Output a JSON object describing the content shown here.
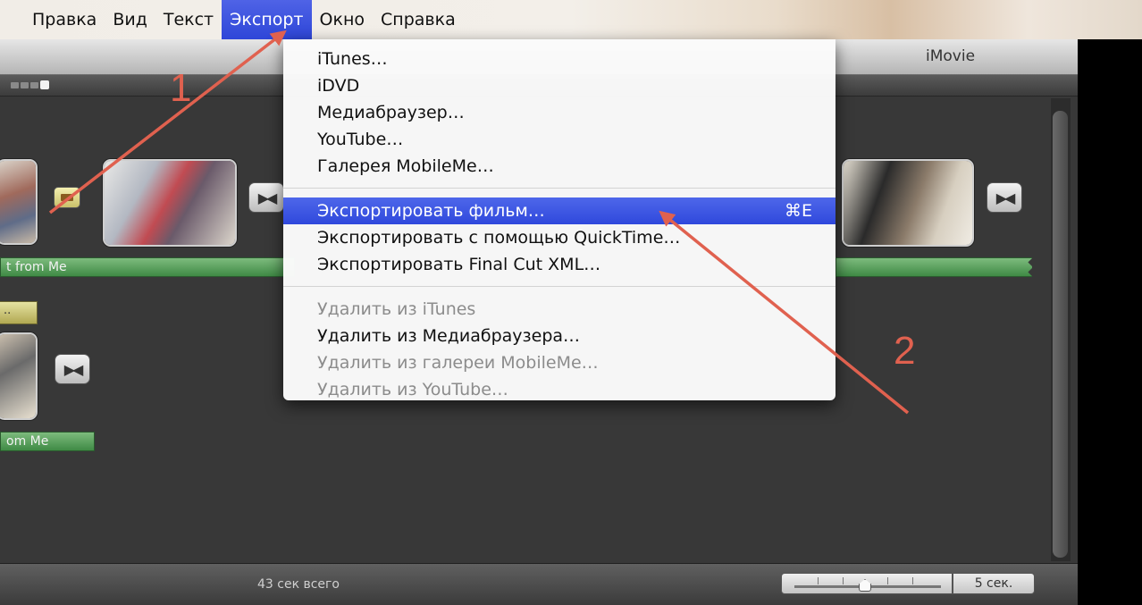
{
  "menubar": {
    "items": [
      {
        "label": "Правка"
      },
      {
        "label": "Вид"
      },
      {
        "label": "Текст"
      },
      {
        "label": "Экспорт",
        "active": true
      },
      {
        "label": "Окно"
      },
      {
        "label": "Справка"
      }
    ]
  },
  "window": {
    "title": "iMovie"
  },
  "project": {
    "music_track_1": "t from Me",
    "music_track_2": "om Me",
    "yellow_chip": "..",
    "status_total": "43 сек всего",
    "speed_label": "5 сек.",
    "zoom_level": 0.52
  },
  "export_menu": {
    "group1": [
      "iTunes…",
      "iDVD",
      "Медиабраузер…",
      "YouTube…",
      "Галерея MobileMe…"
    ],
    "group2": [
      {
        "label": "Экспортировать фильм…",
        "shortcut": "⌘E",
        "highlighted": true
      },
      {
        "label": "Экспортировать с помощью QuickTime…"
      },
      {
        "label": "Экспортировать Final Cut XML…"
      }
    ],
    "group3": [
      {
        "label": "Удалить из iTunes",
        "disabled": true
      },
      {
        "label": "Удалить из Медиабраузера…",
        "disabled": false
      },
      {
        "label": "Удалить из галереи MobileMe…",
        "disabled": true
      },
      {
        "label": "Удалить из YouTube…",
        "disabled": true
      }
    ]
  },
  "annotations": {
    "label1": "1",
    "label2": "2",
    "color": "#e0614f"
  },
  "colors": {
    "highlight": "#3a52e0",
    "music_green": "#4f9a55",
    "pane_bg": "#383838"
  }
}
